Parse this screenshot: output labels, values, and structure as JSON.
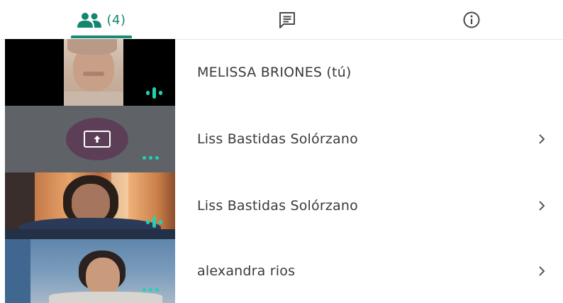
{
  "tabs": {
    "people": {
      "icon": "people-icon",
      "count_label": "(4)",
      "selected": true
    },
    "chat": {
      "icon": "chat-icon"
    },
    "info": {
      "icon": "info-icon"
    }
  },
  "colors": {
    "accent": "#138672",
    "indicator": "#1fd3b1",
    "share_circle": "#5c3f57",
    "text": "#3a3a3a"
  },
  "participants": [
    {
      "name": "MELISSA BRIONES (tú)",
      "tile": "video",
      "status_icon": "speaking-icon",
      "has_chevron": false
    },
    {
      "name": "Liss Bastidas Solórzano",
      "tile": "presentation",
      "status_icon": "more-dots-icon",
      "has_chevron": true
    },
    {
      "name": "Liss Bastidas Solórzano",
      "tile": "video",
      "status_icon": "speaking-icon",
      "has_chevron": true
    },
    {
      "name": "alexandra rios",
      "tile": "video",
      "status_icon": "more-dots-icon",
      "has_chevron": true
    }
  ]
}
